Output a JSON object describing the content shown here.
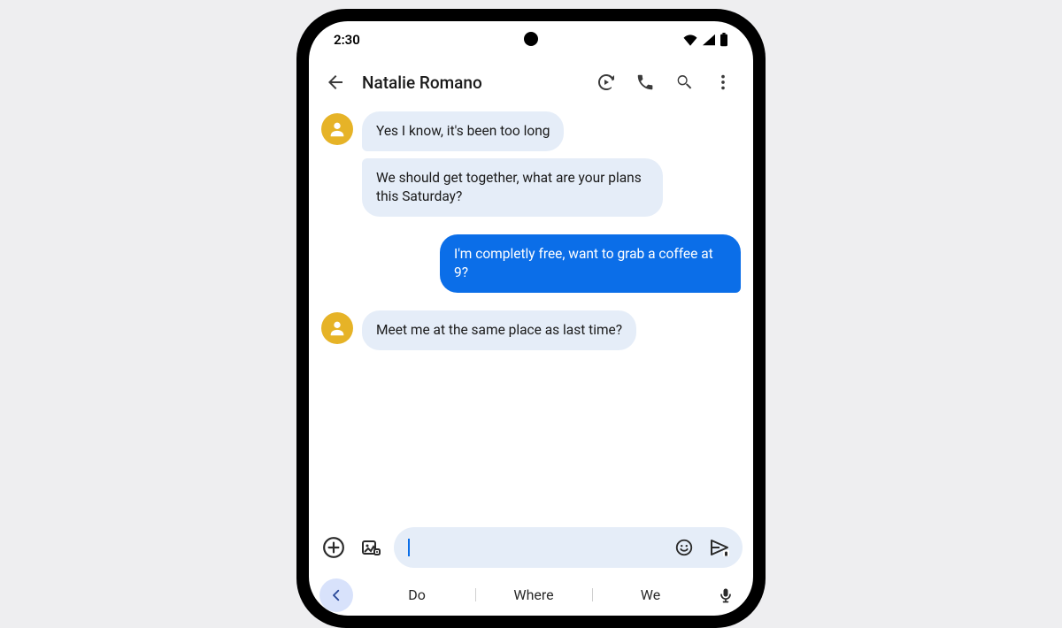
{
  "status": {
    "time": "2:30"
  },
  "header": {
    "contact_name": "Natalie Romano"
  },
  "messages": [
    {
      "direction": "in",
      "show_avatar": true,
      "text": "Yes I know, it's been too long"
    },
    {
      "direction": "in",
      "show_avatar": false,
      "text": "We should get together, what are your plans this Saturday?"
    },
    {
      "direction": "out",
      "show_avatar": false,
      "text": "I'm completly free, want to grab a coffee at 9?"
    },
    {
      "direction": "in",
      "show_avatar": true,
      "text": "Meet me at the same place as last time?"
    }
  ],
  "suggestions": [
    "Do",
    "Where",
    "We"
  ]
}
